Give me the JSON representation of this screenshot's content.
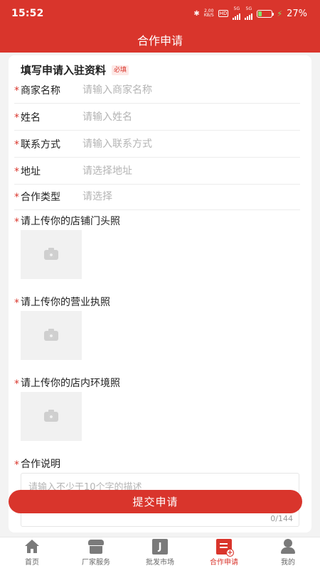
{
  "status_bar": {
    "time": "15:52",
    "speed_value": "2.00",
    "speed_unit": "KB/S",
    "hd_label": "HD",
    "signal_1_label": "5G",
    "signal_2_label": "5G",
    "battery_percent": 27,
    "battery_text": "27%"
  },
  "header": {
    "title": "合作申请"
  },
  "form": {
    "section_title": "填写申请入驻资料",
    "required_badge": "必填",
    "required_mark": "*",
    "fields": [
      {
        "label": "商家名称",
        "placeholder": "请输入商家名称",
        "value": ""
      },
      {
        "label": "姓名",
        "placeholder": "请输入姓名",
        "value": ""
      },
      {
        "label": "联系方式",
        "placeholder": "请输入联系方式",
        "value": ""
      },
      {
        "label": "地址",
        "placeholder": "请选择地址",
        "value": ""
      },
      {
        "label": "合作类型",
        "placeholder": "请选择",
        "value": ""
      }
    ],
    "uploads": [
      {
        "label": "请上传你的店铺门头照"
      },
      {
        "label": "请上传你的营业执照"
      },
      {
        "label": "请上传你的店内环境照"
      }
    ],
    "description": {
      "label": "合作说明",
      "placeholder": "请输入不少于10个字的描述",
      "value": "",
      "counter": "0/144"
    },
    "submit_label": "提交申请"
  },
  "bottom_nav": {
    "items": [
      {
        "label": "首页",
        "icon": "home-icon",
        "active": false
      },
      {
        "label": "厂家服务",
        "icon": "shop-icon",
        "active": false
      },
      {
        "label": "批发市场",
        "icon": "market-icon",
        "icon_text": "J",
        "active": false
      },
      {
        "label": "合作申请",
        "icon": "apply-icon",
        "active": true
      },
      {
        "label": "我的",
        "icon": "profile-icon",
        "active": false
      }
    ]
  },
  "colors": {
    "brand_red": "#d9352c",
    "placeholder_gray": "#b4b4b4",
    "battery_green": "#7fe36b"
  }
}
